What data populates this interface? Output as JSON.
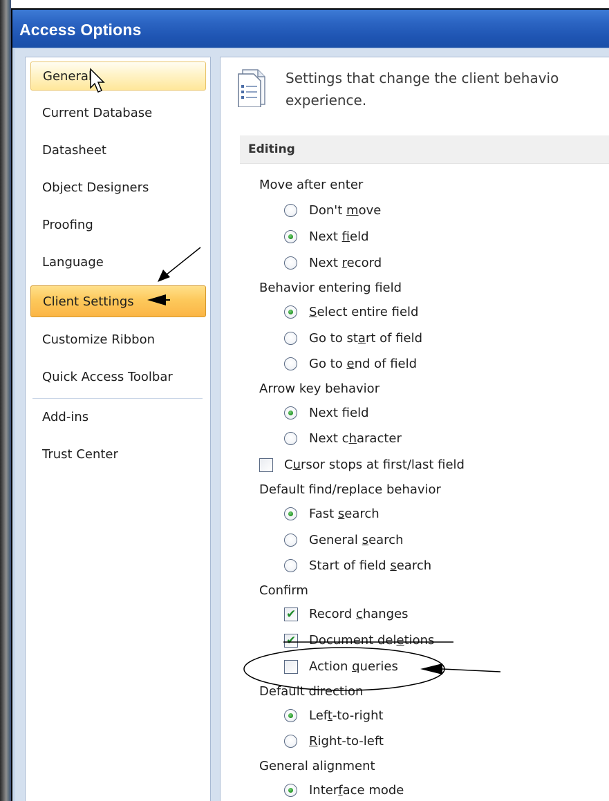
{
  "window": {
    "title": "Access Options"
  },
  "sidebar": {
    "items": [
      {
        "label": "General"
      },
      {
        "label": "Current Database"
      },
      {
        "label": "Datasheet"
      },
      {
        "label": "Object Designers"
      },
      {
        "label": "Proofing"
      },
      {
        "label": "Language"
      },
      {
        "label": "Client Settings"
      },
      {
        "label": "Customize Ribbon"
      },
      {
        "label": "Quick Access Toolbar"
      },
      {
        "label": "Add-ins"
      },
      {
        "label": "Trust Center"
      }
    ]
  },
  "header": {
    "line1": "Settings that change the client behavio",
    "line2": "experience."
  },
  "section": {
    "title": "Editing"
  },
  "groups": {
    "move_after_enter": {
      "label": "Move after enter",
      "options": [
        {
          "pre": "Don't ",
          "u": "m",
          "post": "ove",
          "selected": false
        },
        {
          "pre": "Next ",
          "u": "f",
          "post": "ield",
          "selected": true
        },
        {
          "pre": "Next ",
          "u": "r",
          "post": "ecord",
          "selected": false
        }
      ]
    },
    "behavior_entering": {
      "label": "Behavior entering field",
      "options": [
        {
          "pre": "",
          "u": "S",
          "post": "elect entire field",
          "selected": true
        },
        {
          "pre": "Go to st",
          "u": "a",
          "post": "rt of field",
          "selected": false
        },
        {
          "pre": "Go to ",
          "u": "e",
          "post": "nd of field",
          "selected": false
        }
      ]
    },
    "arrow_key": {
      "label": "Arrow key behavior",
      "options": [
        {
          "pre": "Next f",
          "u": "i",
          "post": "eld",
          "selected": true
        },
        {
          "pre": "Next c",
          "u": "h",
          "post": "aracter",
          "selected": false
        }
      ]
    },
    "cursor_stops": {
      "pre": "C",
      "u": "u",
      "post": "rsor stops at first/last field",
      "checked": false
    },
    "find_replace": {
      "label": "Default find/replace behavior",
      "options": [
        {
          "pre": "Fast ",
          "u": "s",
          "post": "earch",
          "selected": true
        },
        {
          "pre": "General ",
          "u": "s",
          "post": "earch",
          "selected": false
        },
        {
          "pre": "Start of field ",
          "u": "s",
          "post": "earch",
          "selected": false
        }
      ]
    },
    "confirm": {
      "label": "Confirm",
      "options": [
        {
          "pre": "Record ",
          "u": "c",
          "post": "hanges",
          "checked": true
        },
        {
          "pre": "Document del",
          "u": "e",
          "post": "tions",
          "checked": true
        },
        {
          "pre": "Action ",
          "u": "q",
          "post": "ueries",
          "checked": false
        }
      ]
    },
    "default_direction": {
      "label": "Default direction",
      "options": [
        {
          "pre": "Lef",
          "u": "t",
          "post": "-to-right",
          "selected": true
        },
        {
          "pre": "",
          "u": "R",
          "post": "ight-to-left",
          "selected": false
        }
      ]
    },
    "general_alignment": {
      "label": "General alignment",
      "options": [
        {
          "pre": "Inter",
          "u": "f",
          "post": "ace mode",
          "selected": true
        }
      ]
    }
  },
  "colors": {
    "titlebar": "#2b64c2",
    "selected_nav": "#fdc95c",
    "radio_dot": "#2d9c2f",
    "check_mark": "#1f8c2a"
  }
}
